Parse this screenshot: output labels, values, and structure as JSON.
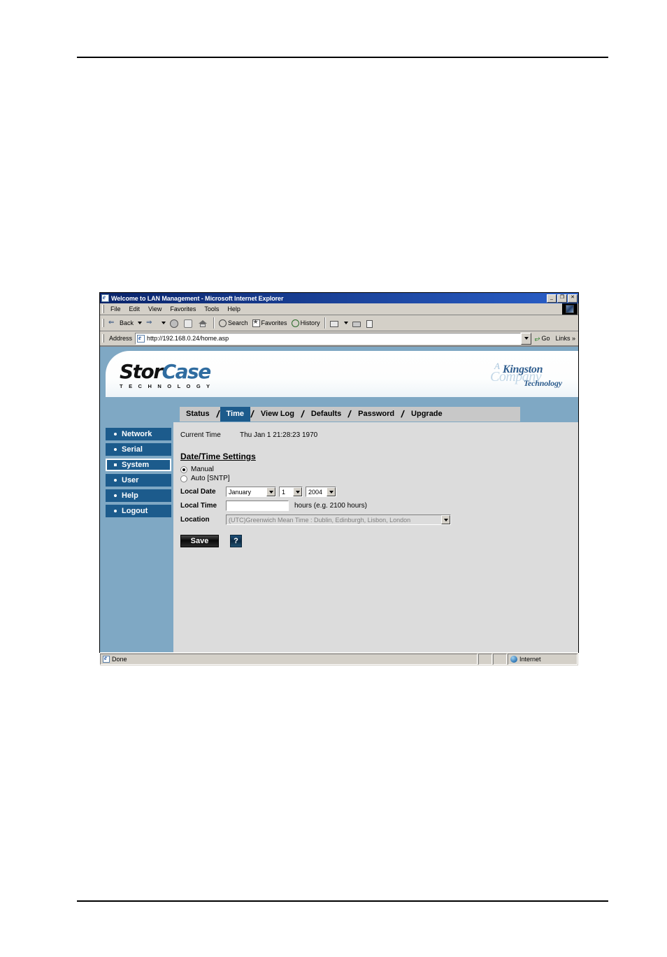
{
  "browser": {
    "title": "Welcome to LAN Management - Microsoft Internet Explorer",
    "menus": [
      "File",
      "Edit",
      "View",
      "Favorites",
      "Tools",
      "Help"
    ],
    "toolbar": {
      "back_label": "Back",
      "search_label": "Search",
      "favorites_label": "Favorites",
      "history_label": "History"
    },
    "address": {
      "label": "Address",
      "value": "http://192.168.0.24/home.asp",
      "go_label": "Go",
      "links_label": "Links"
    },
    "window_buttons": {
      "minimize": "_",
      "restore": "❐",
      "close": "✕"
    },
    "status": {
      "message": "Done",
      "zone": "Internet"
    }
  },
  "banner": {
    "logo_primary_dark": "Stor",
    "logo_primary_accent": "Case",
    "logo_subtitle": "T E C H N O L O G Y",
    "kingston_a": "A",
    "kingston_company": "Company",
    "kingston_name": "Kingston",
    "kingston_technology": "Technology"
  },
  "tabs": [
    {
      "label": "Status",
      "active": false
    },
    {
      "label": "Time",
      "active": true
    },
    {
      "label": "View Log",
      "active": false
    },
    {
      "label": "Defaults",
      "active": false
    },
    {
      "label": "Password",
      "active": false
    },
    {
      "label": "Upgrade",
      "active": false
    }
  ],
  "sidebar": {
    "items": [
      {
        "label": "Network",
        "selected": false
      },
      {
        "label": "Serial",
        "selected": false
      },
      {
        "label": "System",
        "selected": true
      },
      {
        "label": "User",
        "selected": false
      },
      {
        "label": "Help",
        "selected": false
      },
      {
        "label": "Logout",
        "selected": false
      }
    ]
  },
  "main": {
    "current_time_label": "Current Time",
    "current_time_value": "Thu Jan 1 21:28:23 1970",
    "section_title": "Date/Time Settings",
    "mode_manual": "Manual",
    "mode_auto": "Auto [SNTP]",
    "local_date_label": "Local Date",
    "month_value": "January",
    "day_value": "1",
    "year_value": "2004",
    "local_time_label": "Local Time",
    "local_time_value": "",
    "local_time_hint": "hours (e.g. 2100 hours)",
    "location_label": "Location",
    "location_value": "(UTC)Greenwich Mean Time : Dublin, Edinburgh, Lisbon, London",
    "save_label": "Save",
    "help_label": "?"
  },
  "colors": {
    "banner_blue": "#7fa8c4",
    "nav_navy": "#1c5b8c",
    "content_grey": "#dcdcdc",
    "tabstrip_grey": "#c8c8c8",
    "logo_accent": "#2f6ca0"
  }
}
